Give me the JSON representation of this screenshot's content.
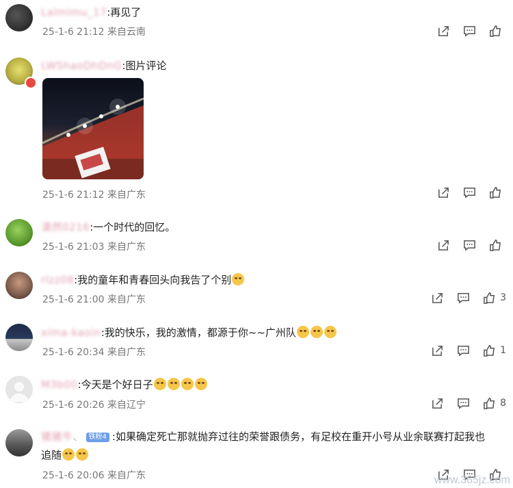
{
  "comments": [
    {
      "user": "Lalmimu_17",
      "text": ":再见了",
      "time": "25-1-6 21:12",
      "location": "来自云南",
      "likes": ""
    },
    {
      "user": "LWShaoDhDnG",
      "text": ":图片评论",
      "time": "25-1-6 21:12",
      "location": "来自广东",
      "likes": ""
    },
    {
      "user": "漠然0216",
      "text": ":一个时代的回忆。",
      "time": "25-1-6 21:03",
      "location": "来自广东",
      "likes": ""
    },
    {
      "user": "rlzz08",
      "text": ":我的童年和青春回头向我告了个别",
      "time": "25-1-6 21:00",
      "location": "来自广东",
      "likes": "3"
    },
    {
      "user": "xima-kaoin",
      "text": ":我的快乐，我的激情，都源于你~~广州队",
      "time": "25-1-6 20:34",
      "location": "来自广东",
      "likes": "1"
    },
    {
      "user": "M3b00",
      "text": ":今天是个好日子",
      "time": "25-1-6 20:26",
      "location": "来自辽宁",
      "likes": "8"
    },
    {
      "user": "猪猪牛",
      "badge": "铁粉4",
      "text": ":如果确定死亡那就抛弃过往的荣誉跟债务，有足校在重开小号从业余联赛打起我也",
      "text2": "追随",
      "time": "25-1-6 20:06",
      "location": "来自广东",
      "likes": ""
    }
  ],
  "watermark": "www.365jz.com"
}
